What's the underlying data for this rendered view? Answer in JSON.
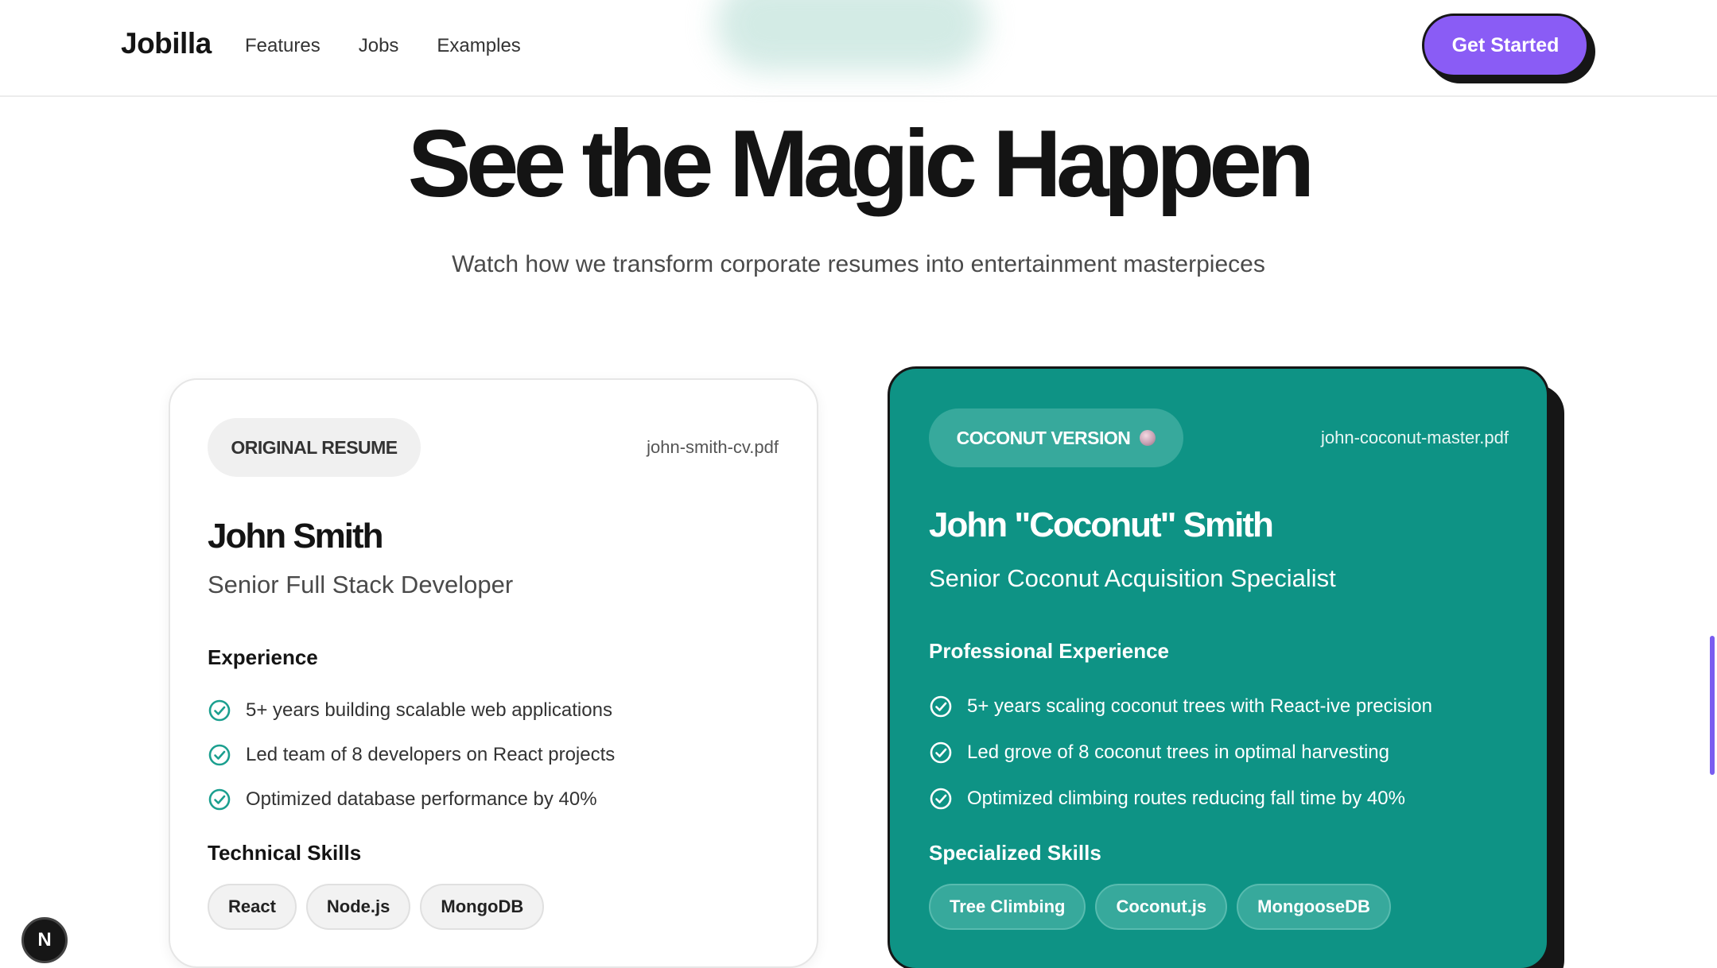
{
  "header": {
    "logo": "Jobilla",
    "nav": [
      "Features",
      "Jobs",
      "Examples"
    ],
    "cta": "Get Started"
  },
  "hero": {
    "title": "See the Magic Happen",
    "subtitle": "Watch how we transform corporate resumes into entertainment masterpieces"
  },
  "original": {
    "badge": "ORIGINAL RESUME",
    "file": "john-smith-cv.pdf",
    "name": "John Smith",
    "role": "Senior Full Stack Developer",
    "experience_heading": "Experience",
    "experience": [
      "5+ years building scalable web applications",
      "Led team of 8 developers on React projects",
      "Optimized database performance by 40%"
    ],
    "skills_heading": "Technical Skills",
    "skills": [
      "React",
      "Node.js",
      "MongoDB"
    ]
  },
  "coconut": {
    "badge": "COCONUT VERSION",
    "badge_icon": "coconut-icon",
    "file": "john-coconut-master.pdf",
    "name": "John \"Coconut\" Smith",
    "role": "Senior Coconut Acquisition Specialist",
    "experience_heading": "Professional Experience",
    "experience": [
      "5+ years scaling coconut trees with React-ive precision",
      "Led grove of 8 coconut trees in optimal harvesting",
      "Optimized climbing routes reducing fall time by 40%"
    ],
    "skills_heading": "Specialized Skills",
    "skills": [
      "Tree Climbing",
      "Coconut.js",
      "MongooseDB"
    ]
  },
  "badge_letter": "N",
  "colors": {
    "accent_purple": "#8a5cf5",
    "teal": "#0e9385",
    "teal_light": "#37a99c",
    "check_teal": "#1b9f8f",
    "ink": "#161616"
  }
}
